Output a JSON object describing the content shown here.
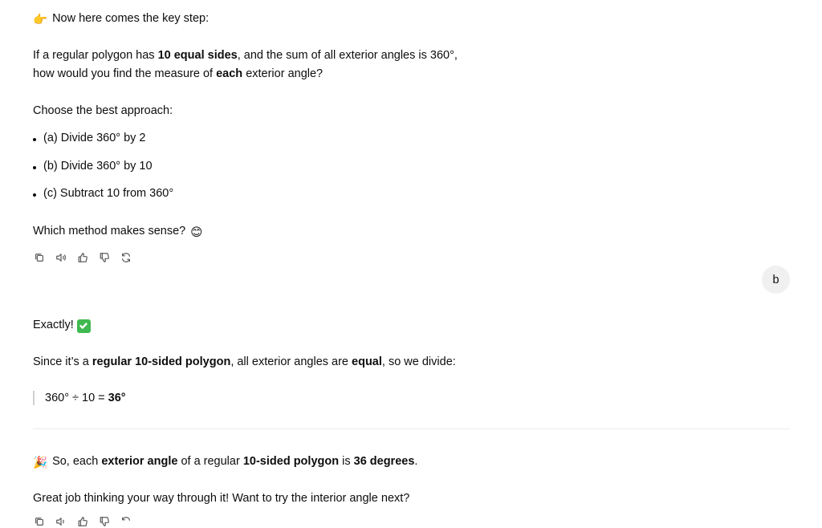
{
  "message1": {
    "intro_emoji": "👉",
    "intro_text": "Now here comes the key step:",
    "q_line1_a": "If a regular polygon has ",
    "q_line1_b": "10 equal sides",
    "q_line1_c": ", and the sum of all exterior angles is 360°,",
    "q_line2_a": "how would you find the measure of ",
    "q_line2_b": "each",
    "q_line2_c": " exterior angle?",
    "choose": "Choose the best approach:",
    "options": [
      "(a) Divide 360° by 2",
      "(b) Divide 360° by 10",
      "(c) Subtract 10 from 360°"
    ],
    "question": "Which method makes sense?",
    "question_emoji": "😊"
  },
  "actions": [
    "copy-icon",
    "speaker-icon",
    "thumbs-up-icon",
    "thumbs-down-icon",
    "regenerate-icon"
  ],
  "user_message": "b",
  "message2": {
    "exactly": "Exactly!",
    "since_a": "Since it’s a ",
    "since_b": "regular 10-sided polygon",
    "since_c": ", all exterior angles are ",
    "since_d": "equal",
    "since_e": ", so we divide:",
    "calc_a": "360° ÷ 10 = ",
    "calc_b": "36°",
    "so_emoji": "🎉",
    "so_a": "So, each ",
    "so_b": "exterior angle",
    "so_c": " of a regular ",
    "so_d": "10-sided polygon",
    "so_e": " is ",
    "so_f": "36 degrees",
    "so_g": ".",
    "great": "Great job thinking your way through it! Want to try the interior angle next?"
  }
}
